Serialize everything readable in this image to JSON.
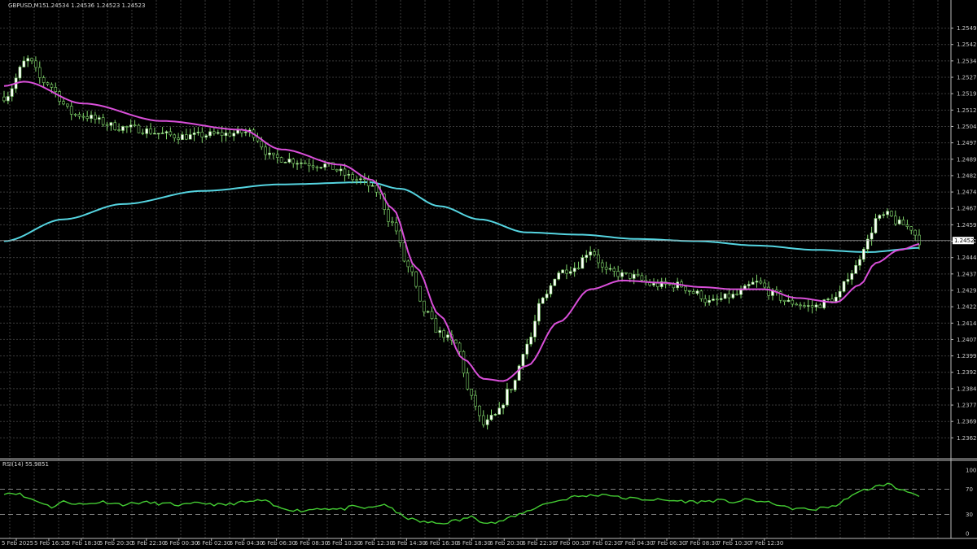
{
  "header": {
    "symbol": "GBPUSD,M15",
    "quote": "1.24534 1.24536 1.24523 1.24523"
  },
  "colors": {
    "background": "#000000",
    "grid": "#3a3a3a",
    "candle_bull_body": "#ffffff",
    "candle_bear_body": "#000000",
    "candle_wick": "#7fd46a",
    "ma_fast": "#d94fd9",
    "ma_slow": "#55d4e0",
    "rsi_line": "#44cc33",
    "axis_text": "#c8c8c8",
    "price_tag_bg": "#ffffff",
    "price_tag_text": "#000000"
  },
  "current_price": "1.24523",
  "chart_data": [
    {
      "type": "candlestick",
      "price_axis": {
        "ylim": [
          1.23558,
          1.25512
        ],
        "ticks": [
          "1.25495",
          "1.25420",
          "1.25345",
          "1.25270",
          "1.25195",
          "1.25120",
          "1.25045",
          "1.24970",
          "1.24895",
          "1.24820",
          "1.24745",
          "1.24670",
          "1.24595",
          "1.24520",
          "1.24445",
          "1.24370",
          "1.24295",
          "1.24220",
          "1.24145",
          "1.24070",
          "1.23995",
          "1.23920",
          "1.23845",
          "1.23770",
          "1.23695",
          "1.23620"
        ]
      },
      "time_axis": {
        "ticks": [
          "5 Feb 2025",
          "5 Feb 16:30",
          "5 Feb 18:30",
          "5 Feb 20:30",
          "5 Feb 22:30",
          "6 Feb 00:30",
          "6 Feb 02:30",
          "6 Feb 04:30",
          "6 Feb 06:30",
          "6 Feb 08:30",
          "6 Feb 10:30",
          "6 Feb 12:30",
          "6 Feb 14:30",
          "6 Feb 16:30",
          "6 Feb 18:30",
          "6 Feb 20:30",
          "6 Feb 22:30",
          "7 Feb 00:30",
          "7 Feb 02:30",
          "7 Feb 04:30",
          "7 Feb 06:30",
          "7 Feb 08:30",
          "7 Feb 10:30",
          "7 Feb 12:30"
        ]
      },
      "price_keypoints": [
        [
          0,
          1.2518
        ],
        [
          6,
          1.2535
        ],
        [
          10,
          1.2525
        ],
        [
          18,
          1.251
        ],
        [
          30,
          1.2504
        ],
        [
          45,
          1.25
        ],
        [
          55,
          1.2501
        ],
        [
          62,
          1.2502
        ],
        [
          68,
          1.249
        ],
        [
          80,
          1.2487
        ],
        [
          90,
          1.248
        ],
        [
          94,
          1.2475
        ],
        [
          98,
          1.246
        ],
        [
          102,
          1.244
        ],
        [
          106,
          1.242
        ],
        [
          110,
          1.241
        ],
        [
          114,
          1.2405
        ],
        [
          118,
          1.238
        ],
        [
          121,
          1.2368
        ],
        [
          124,
          1.2372
        ],
        [
          128,
          1.2385
        ],
        [
          132,
          1.2405
        ],
        [
          136,
          1.2425
        ],
        [
          140,
          1.2438
        ],
        [
          144,
          1.244
        ],
        [
          148,
          1.2448
        ],
        [
          152,
          1.2438
        ],
        [
          158,
          1.2436
        ],
        [
          164,
          1.2432
        ],
        [
          170,
          1.2432
        ],
        [
          175,
          1.2428
        ],
        [
          178,
          1.2424
        ],
        [
          184,
          1.2427
        ],
        [
          190,
          1.2433
        ],
        [
          194,
          1.2428
        ],
        [
          198,
          1.2424
        ],
        [
          204,
          1.2422
        ],
        [
          210,
          1.2426
        ],
        [
          214,
          1.2438
        ],
        [
          218,
          1.2452
        ],
        [
          220,
          1.2462
        ],
        [
          223,
          1.2464
        ],
        [
          226,
          1.246
        ],
        [
          229,
          1.2458
        ],
        [
          231,
          1.2452
        ]
      ],
      "series": [
        {
          "name": "ma_fast",
          "keypoints": [
            [
              0,
              1.2523
            ],
            [
              5,
              1.2525
            ],
            [
              20,
              1.2515
            ],
            [
              40,
              1.2507
            ],
            [
              60,
              1.2503
            ],
            [
              70,
              1.2494
            ],
            [
              85,
              1.2487
            ],
            [
              93,
              1.248
            ],
            [
              98,
              1.2467
            ],
            [
              104,
              1.244
            ],
            [
              110,
              1.2418
            ],
            [
              116,
              1.2398
            ],
            [
              121,
              1.2389
            ],
            [
              126,
              1.2388
            ],
            [
              132,
              1.2395
            ],
            [
              140,
              1.2415
            ],
            [
              148,
              1.243
            ],
            [
              156,
              1.2434
            ],
            [
              166,
              1.2433
            ],
            [
              176,
              1.2431
            ],
            [
              184,
              1.243
            ],
            [
              192,
              1.243
            ],
            [
              200,
              1.2426
            ],
            [
              210,
              1.2424
            ],
            [
              216,
              1.2432
            ],
            [
              220,
              1.2442
            ],
            [
              226,
              1.2448
            ],
            [
              232,
              1.2451
            ]
          ]
        },
        {
          "name": "ma_slow",
          "keypoints": [
            [
              0,
              1.2452
            ],
            [
              15,
              1.2462
            ],
            [
              30,
              1.2469
            ],
            [
              50,
              1.2475
            ],
            [
              70,
              1.2478
            ],
            [
              92,
              1.2479
            ],
            [
              100,
              1.2476
            ],
            [
              110,
              1.2468
            ],
            [
              120,
              1.2462
            ],
            [
              132,
              1.2456
            ],
            [
              145,
              1.2455
            ],
            [
              160,
              1.2453
            ],
            [
              175,
              1.2452
            ],
            [
              190,
              1.245
            ],
            [
              205,
              1.2448
            ],
            [
              218,
              1.2447
            ],
            [
              232,
              1.2449
            ]
          ]
        }
      ]
    },
    {
      "type": "line",
      "ylim": [
        0,
        100
      ],
      "yticks": [
        "100",
        "70",
        "30",
        "0"
      ],
      "levels": [
        70,
        30
      ],
      "series": [
        {
          "name": "RSI(14) 55.9851",
          "keypoints": [
            [
              0,
              64
            ],
            [
              3,
              64
            ],
            [
              6,
              56
            ],
            [
              9,
              50
            ],
            [
              12,
              42
            ],
            [
              15,
              50
            ],
            [
              20,
              46
            ],
            [
              25,
              50
            ],
            [
              30,
              46
            ],
            [
              35,
              49
            ],
            [
              40,
              47
            ],
            [
              45,
              45
            ],
            [
              50,
              48
            ],
            [
              55,
              45
            ],
            [
              60,
              49
            ],
            [
              65,
              52
            ],
            [
              70,
              40
            ],
            [
              75,
              36
            ],
            [
              80,
              40
            ],
            [
              85,
              38
            ],
            [
              88,
              42
            ],
            [
              92,
              40
            ],
            [
              96,
              46
            ],
            [
              100,
              30
            ],
            [
              103,
              22
            ],
            [
              106,
              18
            ],
            [
              110,
              16
            ],
            [
              114,
              20
            ],
            [
              118,
              26
            ],
            [
              121,
              19
            ],
            [
              124,
              17
            ],
            [
              128,
              25
            ],
            [
              132,
              35
            ],
            [
              136,
              46
            ],
            [
              140,
              52
            ],
            [
              144,
              58
            ],
            [
              148,
              60
            ],
            [
              152,
              62
            ],
            [
              156,
              56
            ],
            [
              162,
              54
            ],
            [
              168,
              52
            ],
            [
              175,
              50
            ],
            [
              180,
              52
            ],
            [
              184,
              50
            ],
            [
              188,
              53
            ],
            [
              194,
              48
            ],
            [
              198,
              40
            ],
            [
              204,
              38
            ],
            [
              210,
              44
            ],
            [
              214,
              60
            ],
            [
              218,
              70
            ],
            [
              220,
              74
            ],
            [
              223,
              78
            ],
            [
              226,
              70
            ],
            [
              229,
              66
            ],
            [
              231,
              57
            ]
          ]
        }
      ]
    }
  ]
}
